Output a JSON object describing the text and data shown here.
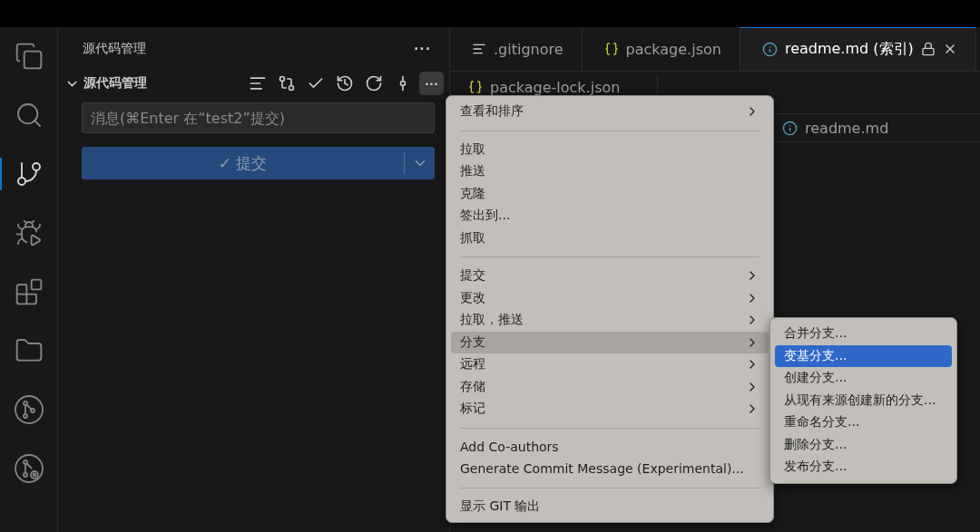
{
  "activity_bar": [
    {
      "kind": "files",
      "selected": false
    },
    {
      "kind": "search",
      "selected": false
    },
    {
      "kind": "source-control",
      "selected": true
    },
    {
      "kind": "run-debug",
      "selected": false
    },
    {
      "kind": "extensions",
      "selected": false
    },
    {
      "kind": "folder",
      "selected": false
    },
    {
      "kind": "git-graph",
      "selected": false
    },
    {
      "kind": "git-search",
      "selected": false
    }
  ],
  "sidebar": {
    "title": "源代码管理",
    "more": "···",
    "section": {
      "title": "源代码管理",
      "expanded": true,
      "more": "···"
    },
    "message": {
      "placeholder": "消息(⌘Enter 在“test2”提交)"
    },
    "commit_button": "✓ 提交"
  },
  "tabs": [
    {
      "label": ".gitignore",
      "kind": "text",
      "selected": false,
      "locked": false
    },
    {
      "label": "package.json",
      "kind": "json",
      "selected": false,
      "locked": false
    },
    {
      "label": "readme.md (索引)",
      "kind": "markdown",
      "selected": true,
      "locked": true
    }
  ],
  "second_group_tab": {
    "label": "package-lock.json",
    "kind": "json"
  },
  "breadcrumb": {
    "label": "readme.md",
    "kind": "markdown"
  },
  "menu": [
    {
      "kind": "item",
      "label": "查看和排序",
      "submenu": true,
      "selected": false
    },
    {
      "kind": "separator"
    },
    {
      "kind": "item",
      "label": "拉取",
      "submenu": false,
      "selected": false
    },
    {
      "kind": "item",
      "label": "推送",
      "submenu": false,
      "selected": false
    },
    {
      "kind": "item",
      "label": "克隆",
      "submenu": false,
      "selected": false
    },
    {
      "kind": "item",
      "label": "签出到...",
      "submenu": false,
      "selected": false
    },
    {
      "kind": "item",
      "label": "抓取",
      "submenu": false,
      "selected": false
    },
    {
      "kind": "separator"
    },
    {
      "kind": "item",
      "label": "提交",
      "submenu": true,
      "selected": false
    },
    {
      "kind": "item",
      "label": "更改",
      "submenu": true,
      "selected": false
    },
    {
      "kind": "item",
      "label": "拉取，推送",
      "submenu": true,
      "selected": false
    },
    {
      "kind": "item",
      "label": "分支",
      "submenu": true,
      "selected": true
    },
    {
      "kind": "item",
      "label": "远程",
      "submenu": true,
      "selected": false
    },
    {
      "kind": "item",
      "label": "存储",
      "submenu": true,
      "selected": false
    },
    {
      "kind": "item",
      "label": "标记",
      "submenu": true,
      "selected": false
    },
    {
      "kind": "separator"
    },
    {
      "kind": "item",
      "label": "Add Co-authors",
      "submenu": false,
      "selected": false
    },
    {
      "kind": "item",
      "label": "Generate Commit Message (Experimental)...",
      "submenu": false,
      "selected": false
    },
    {
      "kind": "separator"
    },
    {
      "kind": "item",
      "label": "显示 GIT 输出",
      "submenu": false,
      "selected": false
    }
  ],
  "submenu": [
    {
      "label": "合并分支...",
      "selected": false
    },
    {
      "label": "变基分支...",
      "selected": true
    },
    {
      "label": "创建分支...",
      "selected": false
    },
    {
      "label": "从现有来源创建新的分支...",
      "selected": false
    },
    {
      "label": "重命名分支...",
      "selected": false
    },
    {
      "label": "删除分支...",
      "selected": false
    },
    {
      "label": "发布分支...",
      "selected": false
    }
  ]
}
